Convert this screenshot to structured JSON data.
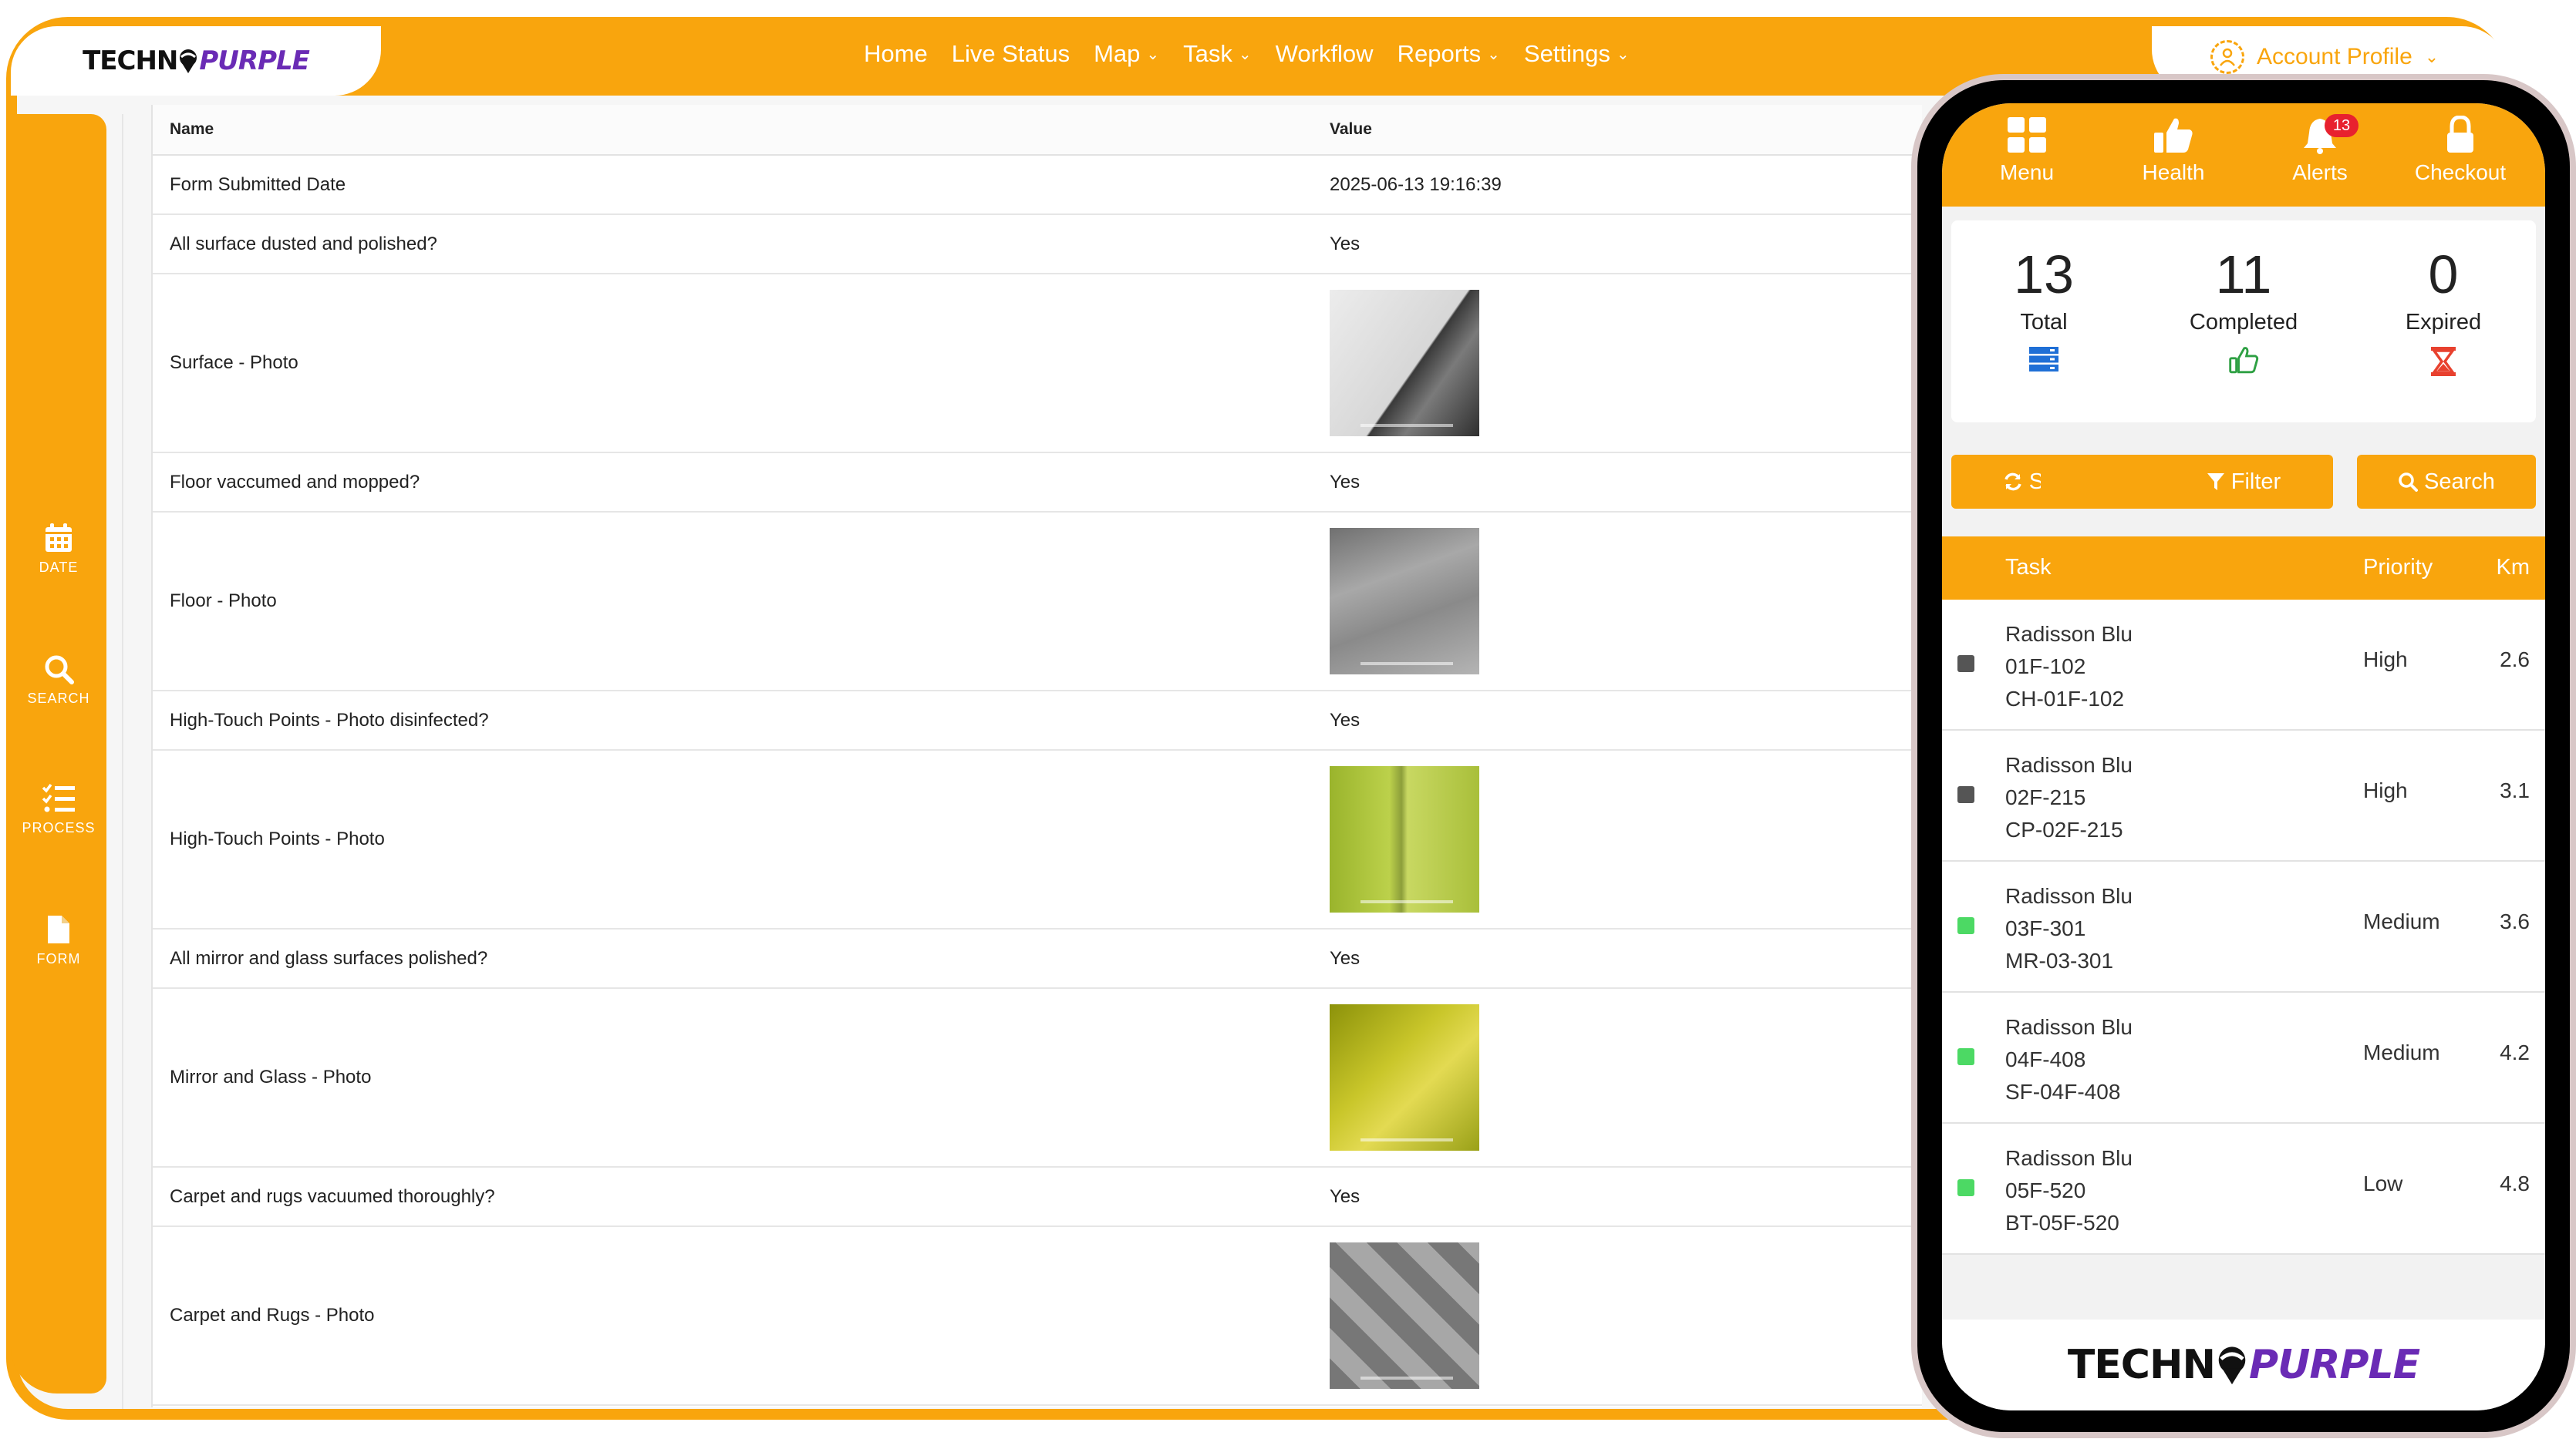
{
  "brand": {
    "logo_left": "TECHN",
    "logo_right": "PURPLE"
  },
  "nav": {
    "items": [
      {
        "label": "Home",
        "dropdown": false
      },
      {
        "label": "Live Status",
        "dropdown": false
      },
      {
        "label": "Map",
        "dropdown": true
      },
      {
        "label": "Task",
        "dropdown": true
      },
      {
        "label": "Workflow",
        "dropdown": false
      },
      {
        "label": "Reports",
        "dropdown": true
      },
      {
        "label": "Settings",
        "dropdown": true
      }
    ],
    "account": {
      "label": "Account Profile",
      "icon": "user-icon"
    }
  },
  "sidebar": {
    "items": [
      {
        "label": "DATE",
        "icon": "calendar-icon"
      },
      {
        "label": "SEARCH",
        "icon": "search-icon"
      },
      {
        "label": "PROCESS",
        "icon": "checklist-icon"
      },
      {
        "label": "FORM",
        "icon": "document-icon"
      }
    ]
  },
  "form_table": {
    "columns": [
      "Name",
      "Value"
    ],
    "rows": [
      {
        "name": "Form Submitted Date",
        "value": "2025-06-13 19:16:39"
      },
      {
        "name": "All surface dusted and polished?",
        "value": "Yes"
      },
      {
        "name": "Surface - Photo",
        "photo": true
      },
      {
        "name": "Floor vaccumed and mopped?",
        "value": "Yes"
      },
      {
        "name": "Floor - Photo",
        "photo": true
      },
      {
        "name": "High-Touch Points - Photo disinfected?",
        "value": "Yes"
      },
      {
        "name": "High-Touch Points - Photo",
        "photo": true
      },
      {
        "name": "All mirror and glass surfaces polished?",
        "value": "Yes"
      },
      {
        "name": "Mirror and Glass - Photo",
        "photo": true
      },
      {
        "name": "Carpet and rugs vacuumed thoroughly?",
        "value": "Yes"
      },
      {
        "name": "Carpet and Rugs - Photo",
        "photo": true
      }
    ]
  },
  "phone": {
    "tabs": [
      {
        "label": "Menu",
        "icon": "grid-icon"
      },
      {
        "label": "Health",
        "icon": "thumbs-up-icon"
      },
      {
        "label": "Alerts",
        "icon": "bell-icon",
        "badge": "13"
      },
      {
        "label": "Checkout",
        "icon": "lock-icon"
      }
    ],
    "stats": [
      {
        "value": "13",
        "label": "Total",
        "icon": "server-icon",
        "color": "#1f6fd6"
      },
      {
        "value": "11",
        "label": "Completed",
        "icon": "thumbs-up-icon",
        "color": "#2ea043"
      },
      {
        "value": "0",
        "label": "Expired",
        "icon": "hourglass-icon",
        "color": "#e8412e"
      }
    ],
    "buttons": [
      {
        "label": "Sync",
        "icon": "refresh-icon"
      },
      {
        "label": "Filter",
        "icon": "filter-icon"
      },
      {
        "label": "Search",
        "icon": "search-icon"
      }
    ],
    "table_headers": {
      "task": "Task",
      "priority": "Priority",
      "km": "Km"
    },
    "tasks": [
      {
        "site": "Radisson Blu",
        "room": "01F-102",
        "code": "CH-01F-102",
        "priority": "High",
        "km": "2.6",
        "status_color": "#555555"
      },
      {
        "site": "Radisson Blu",
        "room": "02F-215",
        "code": "CP-02F-215",
        "priority": "High",
        "km": "3.1",
        "status_color": "#555555"
      },
      {
        "site": "Radisson Blu",
        "room": "03F-301",
        "code": "MR-03-301",
        "priority": "Medium",
        "km": "3.6",
        "status_color": "#4cd964"
      },
      {
        "site": "Radisson Blu",
        "room": "04F-408",
        "code": "SF-04F-408",
        "priority": "Medium",
        "km": "4.2",
        "status_color": "#4cd964"
      },
      {
        "site": "Radisson Blu",
        "room": "05F-520",
        "code": "BT-05F-520",
        "priority": "Low",
        "km": "4.8",
        "status_color": "#4cd964"
      }
    ]
  },
  "colors": {
    "accent": "#f9a50d",
    "brand_purple": "#6a2bb5",
    "alert_red": "#e8212e"
  }
}
